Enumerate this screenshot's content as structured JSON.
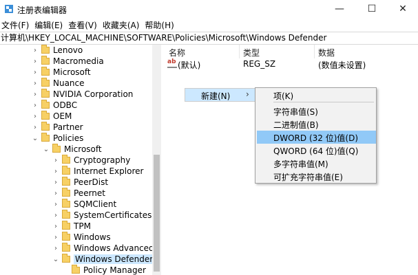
{
  "window": {
    "title": "注册表编辑器",
    "minimize": "—",
    "maximize": "☐",
    "close": "✕"
  },
  "menu": [
    "文件(F)",
    "编辑(E)",
    "查看(V)",
    "收藏夹(A)",
    "帮助(H)"
  ],
  "address": "计算机\\HKEY_LOCAL_MACHINE\\SOFTWARE\\Policies\\Microsoft\\Windows Defender",
  "tree": {
    "rows": [
      {
        "label": "Lenovo",
        "chev": "›"
      },
      {
        "label": "Macromedia",
        "chev": "›"
      },
      {
        "label": "Microsoft",
        "chev": "›"
      },
      {
        "label": "Nuance",
        "chev": "›"
      },
      {
        "label": "NVIDIA Corporation",
        "chev": "›"
      },
      {
        "label": "ODBC",
        "chev": "›"
      },
      {
        "label": "OEM",
        "chev": "›"
      },
      {
        "label": "Partner",
        "chev": "›"
      },
      {
        "label": "Policies",
        "chev": "⌄"
      },
      {
        "label": "Microsoft",
        "chev": "⌄"
      },
      {
        "label": "Cryptography",
        "chev": "›"
      },
      {
        "label": "Internet Explorer",
        "chev": "›"
      },
      {
        "label": "PeerDist",
        "chev": "›"
      },
      {
        "label": "Peernet",
        "chev": "›"
      },
      {
        "label": "SQMClient",
        "chev": "›"
      },
      {
        "label": "SystemCertificates",
        "chev": "›"
      },
      {
        "label": "TPM",
        "chev": "›"
      },
      {
        "label": "Windows",
        "chev": "›"
      },
      {
        "label": "Windows Advanced Threat Protection",
        "chev": "›"
      },
      {
        "label": "Windows Defender",
        "chev": "⌄"
      },
      {
        "label": "Policy Manager",
        "chev": ""
      }
    ]
  },
  "columns": {
    "name": "名称",
    "type": "类型",
    "data": "数据"
  },
  "values": [
    {
      "name": "(默认)",
      "type": "REG_SZ",
      "data": "(数值未设置)"
    }
  ],
  "context_menu": {
    "new_label": "新建(N)",
    "submenu_arrow": "›",
    "items": [
      "项(K)",
      "字符串值(S)",
      "二进制值(B)",
      "DWORD (32 位)值(D)",
      "QWORD (64 位)值(Q)",
      "多字符串值(M)",
      "可扩充字符串值(E)"
    ],
    "highlighted_index": 3
  },
  "colors": {
    "selection": "#cce8ff",
    "menu_highlight": "#91c9f7",
    "folder": "#f7d065"
  }
}
